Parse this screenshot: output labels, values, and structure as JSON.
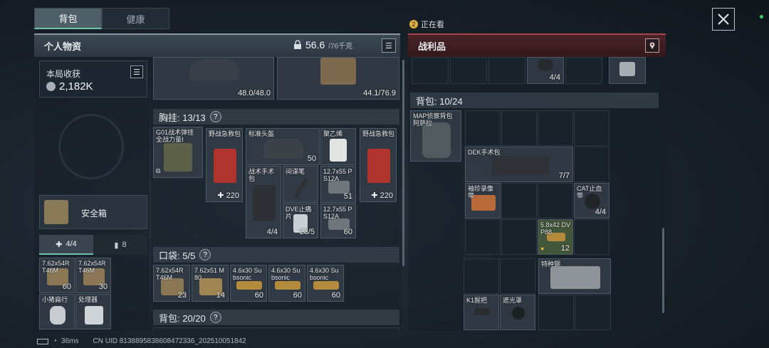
{
  "tabs": [
    {
      "label": "背包"
    },
    {
      "label": "健康"
    }
  ],
  "watching": {
    "label": "正在看"
  },
  "left_panel": {
    "title": "个人物资",
    "weight": "56.6",
    "weight_max": "/76千克"
  },
  "right_panel": {
    "title": "战利品"
  },
  "summary": {
    "label": "本局收获",
    "value": "2,182K"
  },
  "safe_box": {
    "label": "安全箱"
  },
  "sub_tabs": [
    {
      "label": "4/4"
    },
    {
      "label": "8"
    }
  ],
  "equip_top": [
    {
      "qty": "48.0/48.0"
    },
    {
      "qty": "44.1/76.9"
    }
  ],
  "chest": {
    "title": "胸挂: 13/13",
    "items": [
      {
        "name": "G01战术弹挂 全战力量Ⅰ",
        "qty": ""
      },
      {
        "name": "野战急救包",
        "qty": "✚ 220"
      },
      {
        "name": "标准头盔",
        "qty": "50"
      },
      {
        "name": "聚乙烯",
        "qty": ""
      },
      {
        "name": "野战急救包",
        "qty": "✚ 220"
      },
      {
        "name": "战术手术包",
        "qty": "4/4"
      },
      {
        "name": "间谍笔",
        "qty": ""
      },
      {
        "name": "12.7x55 PS12A",
        "qty": "51"
      },
      {
        "name": "DVE止痛片",
        "qty": "23/5"
      },
      {
        "name": "12.7x55 PS12A",
        "qty": "60"
      }
    ]
  },
  "pocket": {
    "title": "口袋: 5/5",
    "items": [
      {
        "name": "7.62x54R T46M",
        "qty": "23"
      },
      {
        "name": "7.62x51 M80",
        "qty": "14"
      },
      {
        "name": "4.6x30 Subsonic",
        "qty": "60"
      },
      {
        "name": "4.6x30 Subsonic",
        "qty": "60"
      },
      {
        "name": "4.6x30 Subsonic",
        "qty": "60"
      }
    ]
  },
  "backpack_left": {
    "title": "背包: 20/20"
  },
  "safe_items": [
    {
      "name": "7.62x54R T46M",
      "qty": "60"
    },
    {
      "name": "7.62x54R T46M",
      "qty": "30"
    },
    {
      "name": "小猪扁行",
      "qty": ""
    },
    {
      "name": "处理器",
      "qty": ""
    }
  ],
  "loot": {
    "top_qty": "4/4",
    "backpack_title": "背包: 10/24",
    "bag_name": "MAP侦察背包 阿萨拉",
    "items": [
      {
        "name": "DEK手术包",
        "qty": "7/7"
      },
      {
        "name": "袖珍录像带",
        "qty": ""
      },
      {
        "name": "CAT止血带",
        "qty": "4/4"
      },
      {
        "name": "5.8x42 DVP88",
        "qty": "12"
      },
      {
        "name": "特种钢",
        "qty": ""
      },
      {
        "name": "K1握把",
        "qty": ""
      },
      {
        "name": "遮光罩",
        "qty": ""
      }
    ]
  },
  "status_bar": {
    "ping": "36ms",
    "uid": "CN UID 8138895838608472336_202510051842"
  },
  "icons": [
    "list-icon",
    "lock-icon",
    "location-icon",
    "close-icon",
    "help-icon",
    "wifi-icon",
    "battery-icon"
  ],
  "colors": {
    "accent": "#6fc3a9",
    "loot_red": "#a8454a",
    "watching_badge": "#e0b040"
  }
}
